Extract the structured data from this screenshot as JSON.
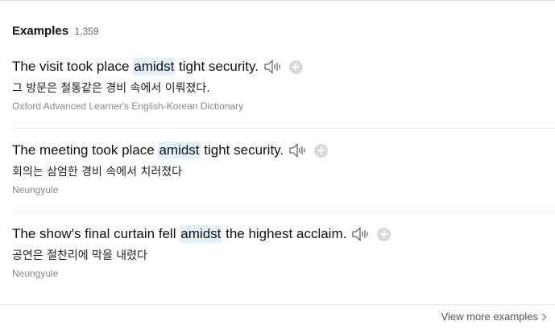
{
  "section": {
    "title": "Examples",
    "count": "1,359"
  },
  "examples": [
    {
      "en_before": "The visit took place ",
      "en_highlight": "amidst",
      "en_after": " tight security.",
      "ko": "그 방문은 철통같은 경비 속에서 이뤄졌다.",
      "source": "Oxford Advanced Learner's English-Korean Dictionary"
    },
    {
      "en_before": "The meeting took place ",
      "en_highlight": "amidst",
      "en_after": " tight security.",
      "ko": "회의는 삼엄한 경비 속에서 치러졌다",
      "source": "Neungyule"
    },
    {
      "en_before": "The show's final curtain fell ",
      "en_highlight": "amidst",
      "en_after": " the highest acclaim.",
      "ko": "공연은 절찬리에 막을 내렸다",
      "source": "Neungyule"
    }
  ],
  "footer": {
    "view_more_label": "View more examples"
  },
  "icons": {
    "speaker": "speaker-icon",
    "add": "plus-circle-icon",
    "chevron": "chevron-right-icon"
  },
  "colors": {
    "highlight": "#e3f1fb",
    "muted": "#8a8a8a"
  }
}
